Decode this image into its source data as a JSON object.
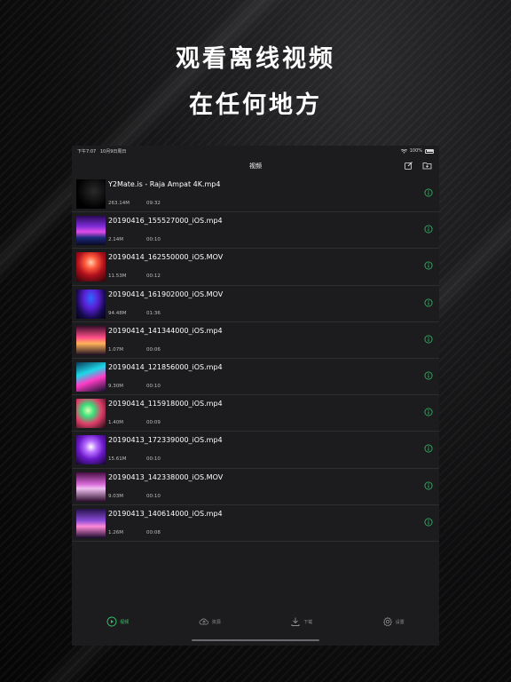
{
  "promo": {
    "line1": "观看离线视频",
    "line2": "在任何地方"
  },
  "status_bar": {
    "time": "下午7:07",
    "date": "10月9日周日",
    "battery": "100%",
    "wifi_icon": "wifi-icon"
  },
  "nav": {
    "title": "视频",
    "actions": [
      "edit-icon",
      "add-folder-icon"
    ]
  },
  "colors": {
    "accent": "#37c36b",
    "background": "#1c1c1e",
    "separator": "#2e2e31"
  },
  "videos": [
    {
      "name": "Y2Mate.is - Raja Ampat 4K.mp4",
      "size": "263.14M",
      "duration": "09:32",
      "thumb": "dark"
    },
    {
      "name": "20190416_155527000_iOS.mp4",
      "size": "2.14M",
      "duration": "00:10",
      "thumb": "purple-stage"
    },
    {
      "name": "20190414_162550000_iOS.MOV",
      "size": "11.53M",
      "duration": "00:12",
      "thumb": "red-fireworks"
    },
    {
      "name": "20190414_161902000_iOS.MOV",
      "size": "94.48M",
      "duration": "01:36",
      "thumb": "blue-crowd"
    },
    {
      "name": "20190414_141344000_iOS.mp4",
      "size": "1.07M",
      "duration": "00:06",
      "thumb": "pink-stage"
    },
    {
      "name": "20190414_121856000_iOS.mp4",
      "size": "9.30M",
      "duration": "00:10",
      "thumb": "cyan-stage"
    },
    {
      "name": "20190414_115918000_iOS.mp4",
      "size": "1.40M",
      "duration": "00:09",
      "thumb": "green-lights"
    },
    {
      "name": "20190413_172339000_iOS.mp4",
      "size": "15.61M",
      "duration": "00:10",
      "thumb": "violet-stage"
    },
    {
      "name": "20190413_142338000_iOS.MOV",
      "size": "9.03M",
      "duration": "00:10",
      "thumb": "magenta-haze"
    },
    {
      "name": "20190413_140614000_iOS.mp4",
      "size": "1.26M",
      "duration": "00:08",
      "thumb": "purple-beams"
    }
  ],
  "tabs": [
    {
      "label": "视频",
      "icon": "play-icon",
      "active": true
    },
    {
      "label": "资源",
      "icon": "cloud-icon",
      "active": false
    },
    {
      "label": "下载",
      "icon": "download-icon",
      "active": false
    },
    {
      "label": "设置",
      "icon": "gear-icon",
      "active": false
    }
  ]
}
